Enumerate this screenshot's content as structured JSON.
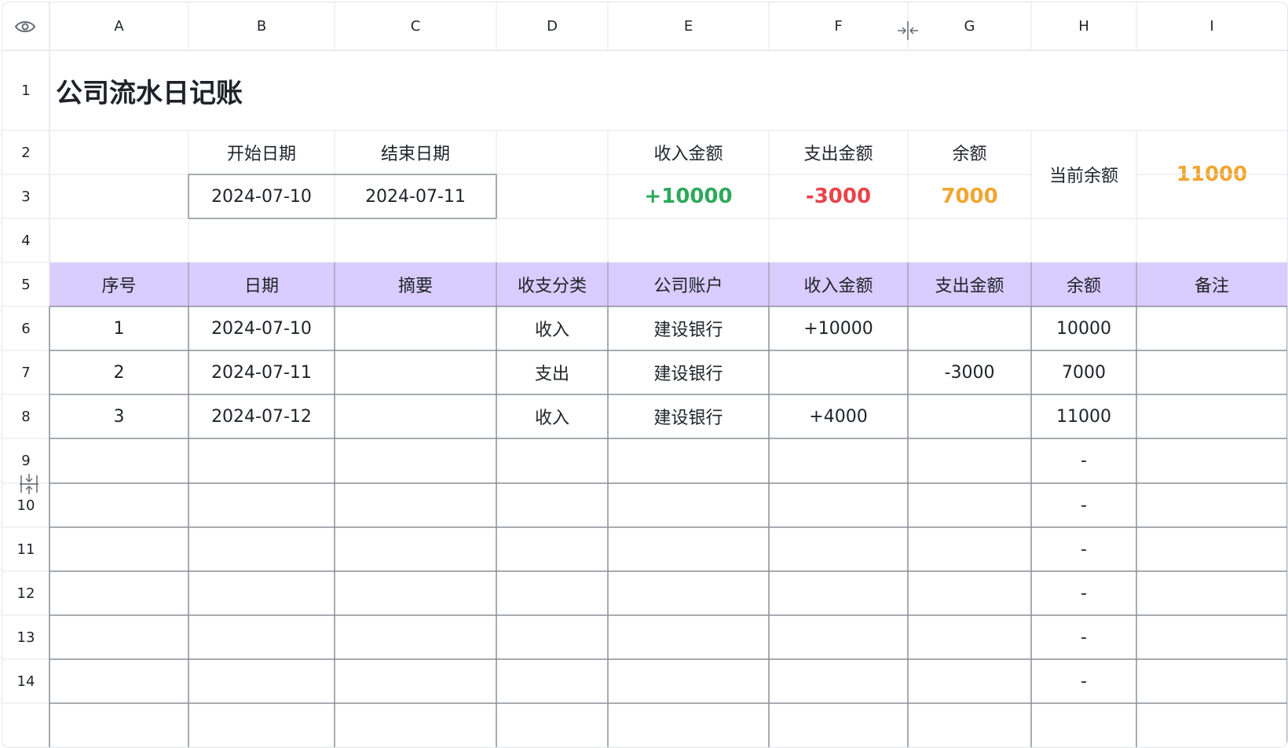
{
  "columns": [
    "A",
    "B",
    "C",
    "D",
    "E",
    "F",
    "G",
    "H",
    "I"
  ],
  "rows": [
    "1",
    "2",
    "3",
    "4",
    "5",
    "6",
    "7",
    "8",
    "9",
    "10",
    "11",
    "12",
    "13",
    "14"
  ],
  "title": "公司流水日记账",
  "period": {
    "start_label": "开始日期",
    "end_label": "结束日期",
    "start_value": "2024-07-10",
    "end_value": "2024-07-11"
  },
  "summary": {
    "income_label": "收入金额",
    "expense_label": "支出金额",
    "balance_label": "余额",
    "income_value": "+10000",
    "expense_value": "-3000",
    "balance_value": "7000",
    "current_label": "当前余额",
    "current_value": "11000"
  },
  "table": {
    "headers": [
      "序号",
      "日期",
      "摘要",
      "收支分类",
      "公司账户",
      "收入金额",
      "支出金额",
      "余额",
      "备注"
    ],
    "rows": [
      [
        "1",
        "2024-07-10",
        "",
        "收入",
        "建设银行",
        "+10000",
        "",
        "10000",
        ""
      ],
      [
        "2",
        "2024-07-11",
        "",
        "支出",
        "建设银行",
        "",
        "-3000",
        "7000",
        ""
      ],
      [
        "3",
        "2024-07-12",
        "",
        "收入",
        "建设银行",
        "+4000",
        "",
        "11000",
        ""
      ],
      [
        "",
        "",
        "",
        "",
        "",
        "",
        "",
        "-",
        ""
      ],
      [
        "",
        "",
        "",
        "",
        "",
        "",
        "",
        "-",
        ""
      ],
      [
        "",
        "",
        "",
        "",
        "",
        "",
        "",
        "-",
        ""
      ],
      [
        "",
        "",
        "",
        "",
        "",
        "",
        "",
        "-",
        ""
      ],
      [
        "",
        "",
        "",
        "",
        "",
        "",
        "",
        "-",
        ""
      ],
      [
        "",
        "",
        "",
        "",
        "",
        "",
        "",
        "-",
        ""
      ]
    ]
  },
  "icons": {
    "corner": "eye-icon",
    "col_resize": "column-resize-icon",
    "row_resize": "row-resize-icon"
  },
  "colors": {
    "header_fill": "#d9ccff",
    "income": "#2ea85b",
    "expense": "#e8444a",
    "balance": "#f0a630",
    "grid_light": "#e5e6eb",
    "grid_dark": "#8a8f99"
  }
}
